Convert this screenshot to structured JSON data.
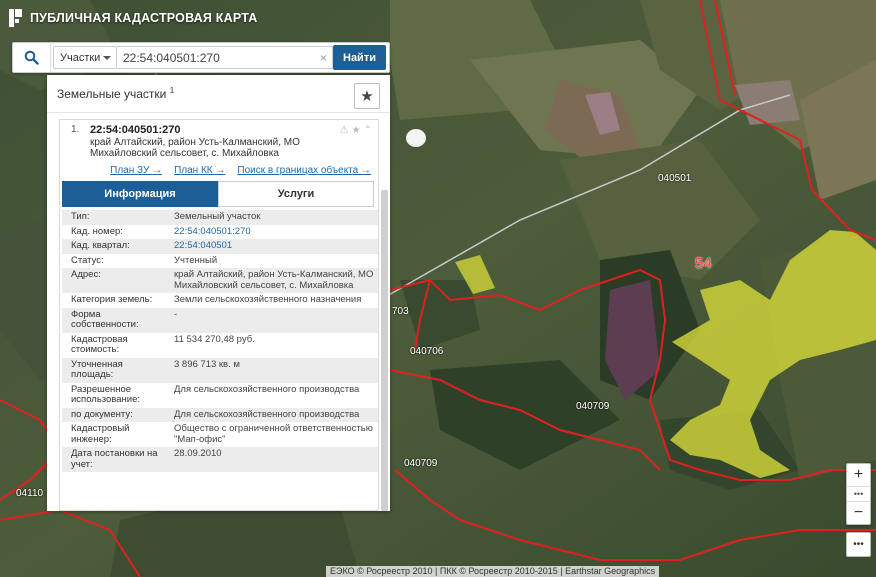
{
  "app": {
    "title": "ПУБЛИЧНАЯ КАДАСТРОВАЯ КАРТА"
  },
  "search": {
    "type_label": "Участки",
    "query": "22:54:040501:270",
    "button_label": "Найти"
  },
  "panel": {
    "title": "Земельные участки",
    "count": "1"
  },
  "result": {
    "number": "1.",
    "cadastral_number": "22:54:040501:270",
    "address": "край Алтайский, район Усть-Калманский, МО Михайловский сельсовет, с. Михайловка",
    "links": [
      "План ЗУ →",
      "План КК →",
      "Поиск в границах объекта →"
    ],
    "tabs": [
      "Информация",
      "Услуги"
    ]
  },
  "info": [
    {
      "key": "Тип:",
      "value": "Земельный участок"
    },
    {
      "key": "Кад. номер:",
      "value": "22:54:040501:270"
    },
    {
      "key": "Кад. квартал:",
      "value": "22:54:040501"
    },
    {
      "key": "Статус:",
      "value": "Учтенный"
    },
    {
      "key": "Адрес:",
      "value": "край Алтайский, район Усть-Калманский, МО Михайловский сельсовет, с. Михайловка"
    },
    {
      "key": "Категория земель:",
      "value": "Земли сельскохозяйственного назначения"
    },
    {
      "key": "Форма собственности:",
      "value": "-"
    },
    {
      "key": "Кадастровая стоимость:",
      "value": "11 534 270,48 руб."
    },
    {
      "key": "Уточненная площадь:",
      "value": "3 896 713 кв. м"
    },
    {
      "key": "Разрешенное использование:",
      "value": "Для сельскохозяйственного производства"
    },
    {
      "key": "по документу:",
      "value": "Для сельскохозяйственного производства"
    },
    {
      "key": "Кадастровый инженер:",
      "value": "Общество с ограниченной ответственностью \"Мап-офис\""
    },
    {
      "key": "Дата постановки на учет:",
      "value": "28.09.2010"
    }
  ],
  "map_labels": {
    "quarter_1": "040501",
    "quarter_2": "040706",
    "quarter_3": "040709",
    "quarter_4": "040709",
    "quarter_5": "04110",
    "quarter_6": "703",
    "district": "54"
  },
  "zoom": {
    "in": "+",
    "out": "−",
    "more": "•••"
  },
  "attribution": "ЕЭКО © Росреестр 2010 | ПКК © Росреестр 2010-2015 | Earthstar Geographics"
}
